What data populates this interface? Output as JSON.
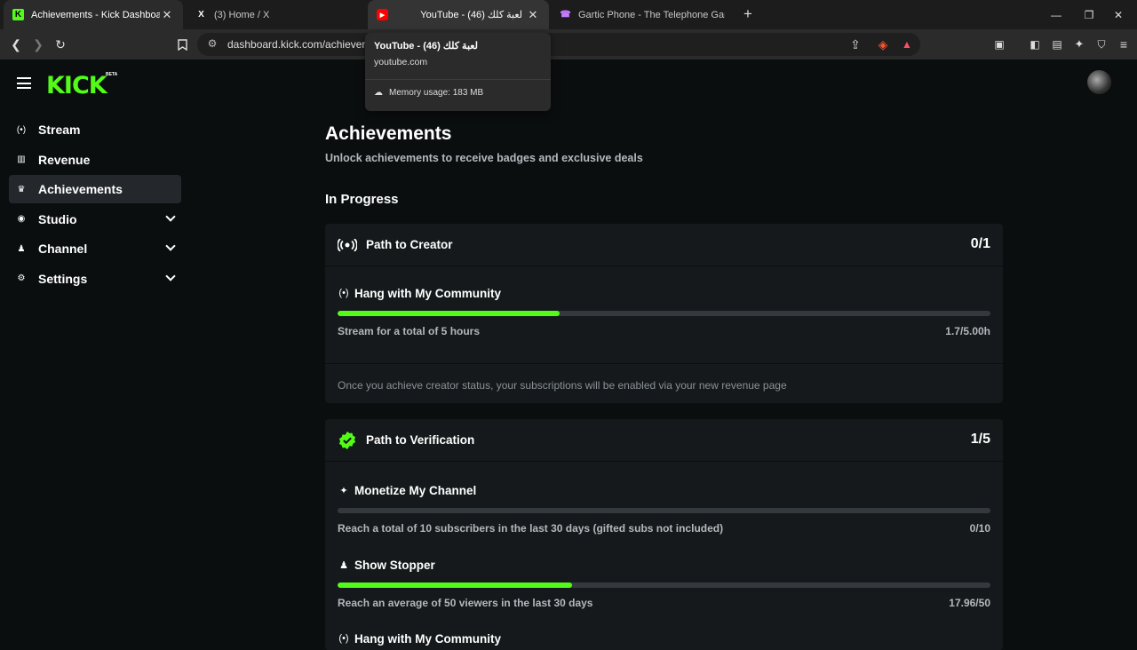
{
  "browser": {
    "tabs": [
      {
        "title": "Achievements - Kick Dashboard",
        "favicon": "K"
      },
      {
        "title": "(3) Home / X",
        "favicon": "X"
      },
      {
        "title": "YouTube - لعبة كلك (46)",
        "favicon": "▶"
      },
      {
        "title": "Gartic Phone - The Telephone Game",
        "favicon": "☎"
      }
    ],
    "url": "dashboard.kick.com/achievements",
    "tooltip": {
      "title": "YouTube - لعبة كلك (46)",
      "domain": "youtube.com",
      "memory": "Memory usage: 183 MB"
    }
  },
  "app": {
    "logo": "KICK",
    "logo_badge": "BETA",
    "accent": "#53fc18"
  },
  "nav": {
    "items": [
      {
        "label": "Stream",
        "icon": "broadcast-icon"
      },
      {
        "label": "Revenue",
        "icon": "chart-icon"
      },
      {
        "label": "Achievements",
        "icon": "trophy-icon"
      },
      {
        "label": "Studio",
        "icon": "studio-icon"
      },
      {
        "label": "Channel",
        "icon": "channel-icon"
      },
      {
        "label": "Settings",
        "icon": "gear-icon"
      }
    ]
  },
  "main": {
    "title": "Achievements",
    "subtitle": "Unlock achievements to receive badges and exclusive deals",
    "section": "In Progress",
    "cards": [
      {
        "title": "Path to Creator",
        "count": "0/1",
        "tasks": [
          {
            "title": "Hang with My Community",
            "desc": "Stream for a total of 5 hours",
            "value": "1.7/5.00h",
            "progress": 0.34
          }
        ],
        "note": "Once you achieve creator status, your subscriptions will be enabled via your new revenue page"
      },
      {
        "title": "Path to Verification",
        "count": "1/5",
        "tasks": [
          {
            "title": "Monetize My Channel",
            "desc": "Reach a total of 10 subscribers in the last 30 days (gifted subs not included)",
            "value": "0/10",
            "progress": 0
          },
          {
            "title": "Show Stopper",
            "desc": "Reach an average of 50 viewers in the last 30 days",
            "value": "17.96/50",
            "progress": 0.359
          },
          {
            "title": "Hang with My Community"
          }
        ]
      }
    ]
  }
}
